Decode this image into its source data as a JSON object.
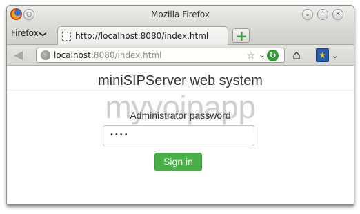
{
  "window": {
    "title": "Mozilla Firefox"
  },
  "tabbar": {
    "menu_label": "Firefox",
    "menu_chevron": "❯",
    "tab_title": "http://localhost:8080/index.html",
    "new_tab_symbol": "+"
  },
  "navbar": {
    "url_host": "localhost",
    "url_rest": ":8080/index.html",
    "back_symbol": "◀",
    "star_symbol": "☆",
    "dropdown_symbol": "⌄",
    "reload_symbol": "↻",
    "home_symbol": "⌂",
    "bookmark_symbol": "★"
  },
  "page": {
    "title": "miniSIPServer web system",
    "watermark": "myvoipapp",
    "password_label": "Administrator password",
    "password_value": "••••",
    "signin_label": "Sign in"
  },
  "colors": {
    "signin_button": "#47b048",
    "reload_green": "#2f9a2f",
    "new_tab_plus": "#3aa53a"
  },
  "icons": {
    "firefox_logo": "firefox-logo-icon",
    "window_controls": [
      "minimize-icon",
      "maximize-icon",
      "close-icon"
    ],
    "tab_favicon": "blank-page-icon",
    "url_site": "globe-icon"
  }
}
